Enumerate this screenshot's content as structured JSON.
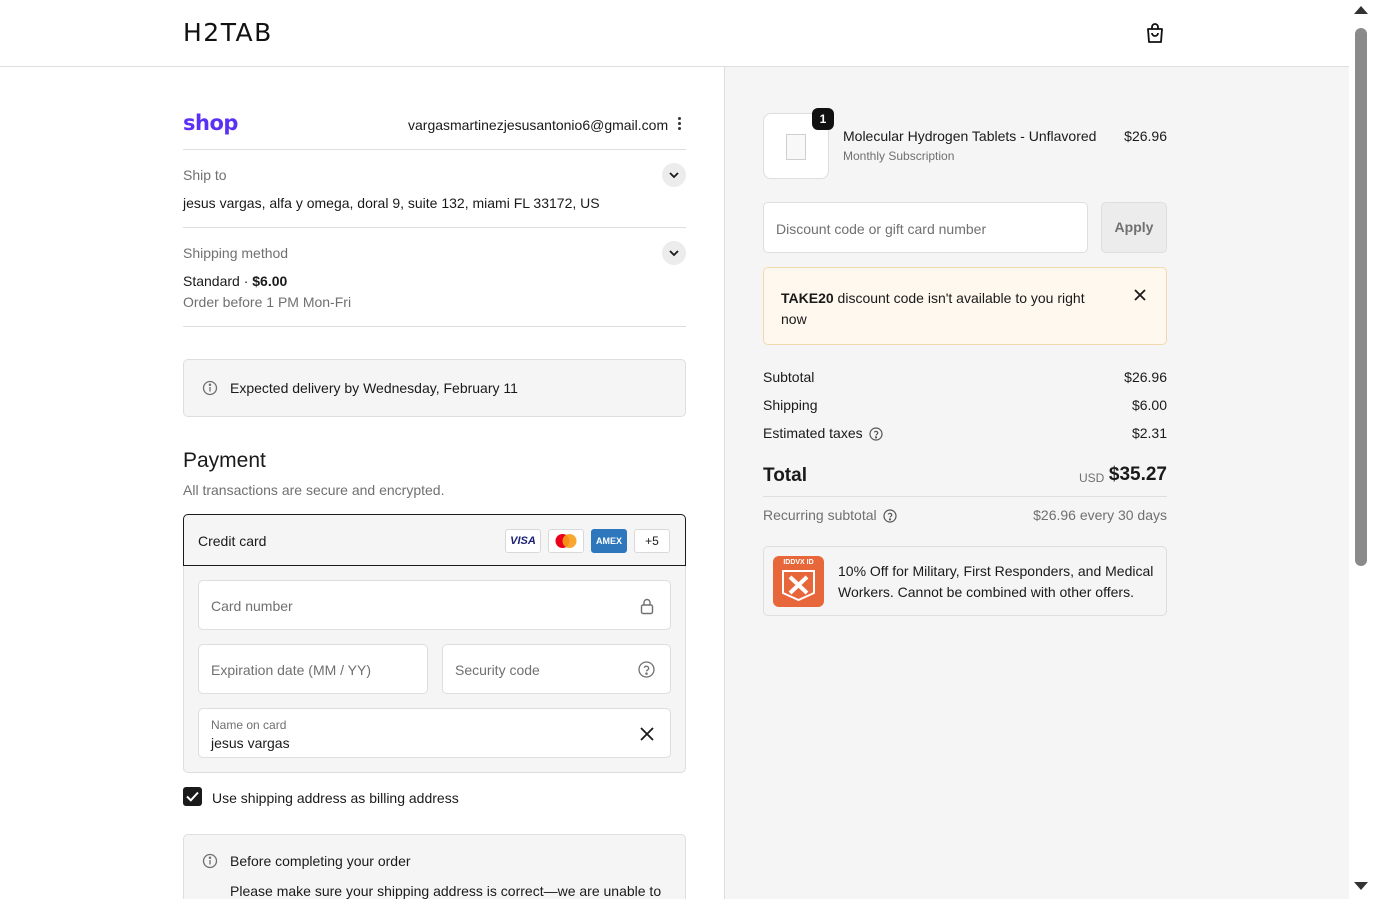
{
  "header": {
    "logo": "H2TAB",
    "cart_icon": "shopping-bag-icon"
  },
  "account": {
    "shop_brand": "shop",
    "email": "vargasmartinezjesusantonio6@gmail.com"
  },
  "ship_to": {
    "label": "Ship to",
    "address": "jesus vargas, alfa y omega, doral 9, suite 132, miami FL 33172, US"
  },
  "shipping_method": {
    "label": "Shipping method",
    "name": "Standard · ",
    "price": "$6.00",
    "note": "Order before 1 PM Mon-Fri"
  },
  "delivery": {
    "text": "Expected delivery by Wednesday, February 11"
  },
  "payment": {
    "title": "Payment",
    "subtitle": "All transactions are secure and encrypted.",
    "method_label": "Credit card",
    "card_brands": [
      "VISA",
      "mastercard",
      "AMEX"
    ],
    "more_brands": "+5",
    "card_number_placeholder": "Card number",
    "expiry_placeholder": "Expiration date (MM / YY)",
    "security_placeholder": "Security code",
    "name_label": "Name on card",
    "name_value": "jesus vargas",
    "billing_checkbox_label": "Use shipping address as billing address",
    "billing_checked": true
  },
  "notice": {
    "title": "Before completing your order",
    "body": "Please make sure your shipping address is correct—we are unable to"
  },
  "order": {
    "quantity": "1",
    "product_name": "Molecular Hydrogen Tablets - Unflavored",
    "product_sub": "Monthly Subscription",
    "product_price": "$26.96"
  },
  "discount": {
    "placeholder": "Discount code or gift card number",
    "apply_label": "Apply",
    "error_code": "TAKE20",
    "error_text": " discount code isn't available to you right now"
  },
  "summary": {
    "subtotal_label": "Subtotal",
    "subtotal_value": "$26.96",
    "shipping_label": "Shipping",
    "shipping_value": "$6.00",
    "taxes_label": "Estimated taxes",
    "taxes_value": "$2.31",
    "total_label": "Total",
    "total_currency": "USD",
    "total_value": "$35.27",
    "recurring_label": "Recurring subtotal",
    "recurring_value": "$26.96 every 30 days"
  },
  "promo": {
    "logo_text": "IDDVX ID",
    "text": "10% Off for Military, First Responders, and Medical Workers. Cannot be combined with other offers."
  },
  "colors": {
    "shop_brand": "#5a31f4",
    "warning_bg": "#fff8ee",
    "promo_logo": "#e8673a"
  }
}
